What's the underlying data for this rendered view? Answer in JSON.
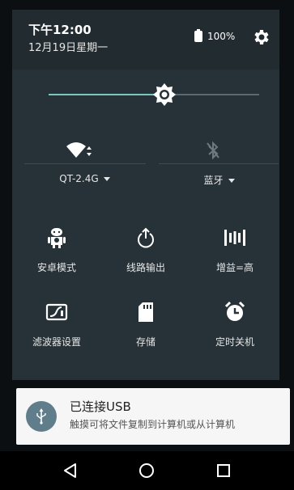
{
  "status": {
    "time": "下午12:00",
    "date": "12月19日星期一",
    "battery": "100%"
  },
  "brightness": {
    "level": 0.55
  },
  "quick_settings": {
    "wifi_label": "QT-2.4G",
    "bluetooth_label": "蓝牙"
  },
  "tiles": [
    {
      "label": "安卓模式",
      "icon": "android-icon"
    },
    {
      "label": "线路输出",
      "icon": "power-output-icon"
    },
    {
      "label": "增益=高",
      "icon": "gain-bars-icon"
    },
    {
      "label": "滤波器设置",
      "icon": "filter-icon"
    },
    {
      "label": "存储",
      "icon": "sd-card-icon"
    },
    {
      "label": "定时关机",
      "icon": "alarm-icon"
    }
  ],
  "notification": {
    "title": "已连接USB",
    "text": "触摸可将文件复制到计算机或从计算机"
  },
  "colors": {
    "accent": "#78c6c0",
    "shade_bg": "#263238",
    "notification_icon_bg": "#607d8b"
  }
}
